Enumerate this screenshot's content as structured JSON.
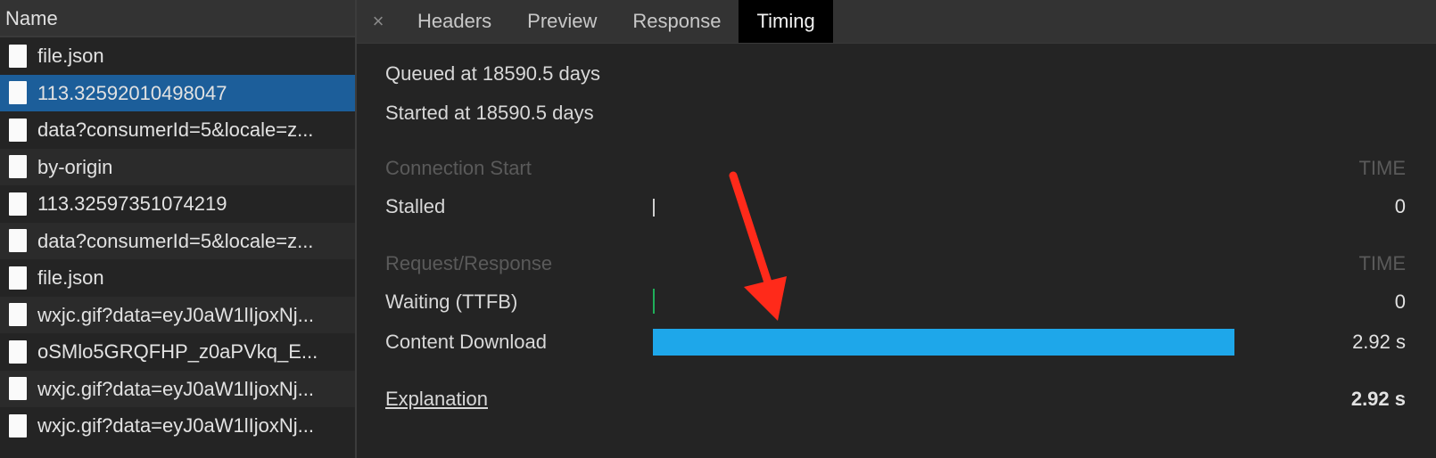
{
  "sidebar": {
    "header": "Name",
    "rows": [
      {
        "label": "file.json"
      },
      {
        "label": "113.32592010498047"
      },
      {
        "label": "data?consumerId=5&locale=z..."
      },
      {
        "label": "by-origin"
      },
      {
        "label": "113.32597351074219"
      },
      {
        "label": "data?consumerId=5&locale=z..."
      },
      {
        "label": "file.json"
      },
      {
        "label": "wxjc.gif?data=eyJ0aW1lIjoxNj..."
      },
      {
        "label": "oSMlo5GRQFHP_z0aPVkq_E..."
      },
      {
        "label": "wxjc.gif?data=eyJ0aW1lIjoxNj..."
      },
      {
        "label": "wxjc.gif?data=eyJ0aW1lIjoxNj..."
      }
    ]
  },
  "tabs": {
    "close": "×",
    "items": [
      "Headers",
      "Preview",
      "Response",
      "Timing"
    ],
    "active": "Timing"
  },
  "timing": {
    "queued": "Queued at 18590.5 days",
    "started": "Started at 18590.5 days",
    "connection_section": "Connection Start",
    "request_section": "Request/Response",
    "time_header": "TIME",
    "stalled_label": "Stalled",
    "stalled_value": "0",
    "waiting_label": "Waiting (TTFB)",
    "waiting_value": "0",
    "download_label": "Content Download",
    "download_value": "2.92 s",
    "explanation_label": "Explanation",
    "total_value": "2.92 s"
  },
  "colors": {
    "selected_row": "#1c5e9a",
    "download_bar": "#1ea7ea",
    "waiting_tick": "#1fae5a",
    "annotation_arrow": "#ff2a1a"
  }
}
